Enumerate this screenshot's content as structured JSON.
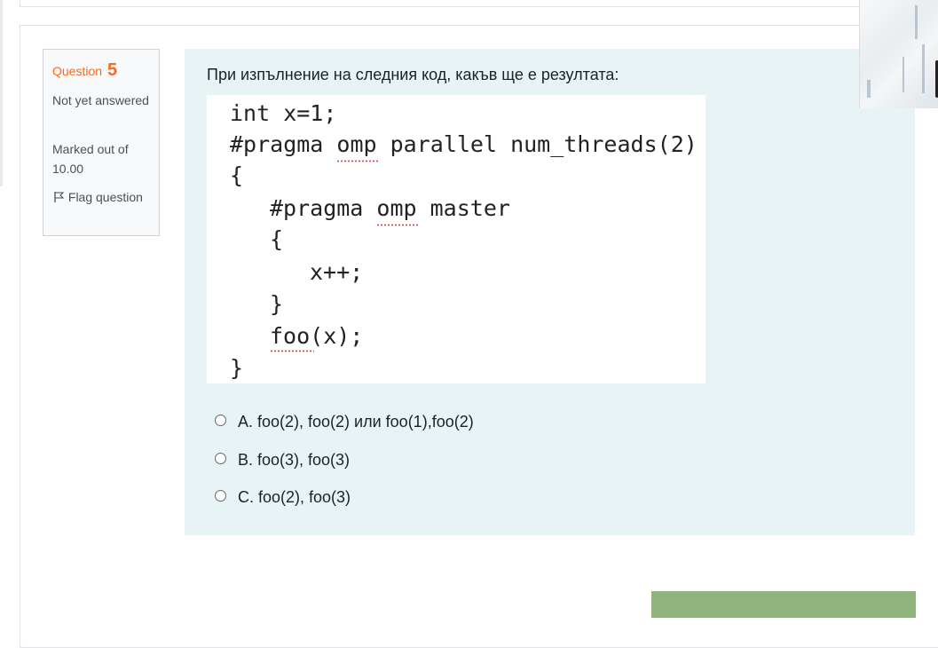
{
  "question": {
    "label": "Question",
    "number": "5",
    "state": "Not yet answered",
    "grade": "Marked out of 10.00",
    "flag_label": "Flag question",
    "flag_icon": "flag-icon",
    "text": "При изпълнение на следния код, какъв ще е резултата:"
  },
  "code": {
    "lines": [
      "int x=1;",
      "#pragma omp parallel num_threads(2)",
      "{",
      "#pragma omp master",
      "{",
      "x++;",
      "}",
      "foo(x);",
      "}"
    ]
  },
  "answers": [
    {
      "label": "A. foo(2), foo(2) или foo(1),foo(2)"
    },
    {
      "label": "B. foo(3), foo(3)"
    },
    {
      "label": "C. foo(2), foo(3)"
    }
  ],
  "colors": {
    "accent": "#f26d21",
    "content_bg": "#e7f3f5",
    "button_green": "#90b47e"
  }
}
